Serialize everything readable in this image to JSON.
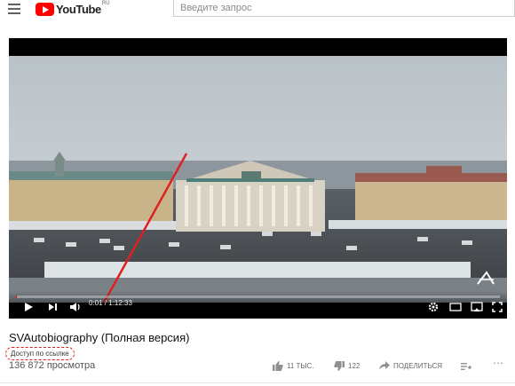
{
  "header": {
    "logo_text": "YouTube",
    "logo_region": "RU",
    "search_placeholder": "Введите запрос"
  },
  "player": {
    "time_current": "0:01",
    "time_total": "1:12:33",
    "progress": 0.0002
  },
  "video": {
    "title": "SVAutobiography (Полная версия)",
    "access_label": "Доступ по ссылке",
    "views": "136 872 просмотра",
    "likes": "11 ТЫС.",
    "dislikes": "122",
    "share_label": "ПОДЕЛИТЬСЯ"
  },
  "colors": {
    "brand_red": "#ff0000",
    "annotation_red": "#e02020"
  }
}
